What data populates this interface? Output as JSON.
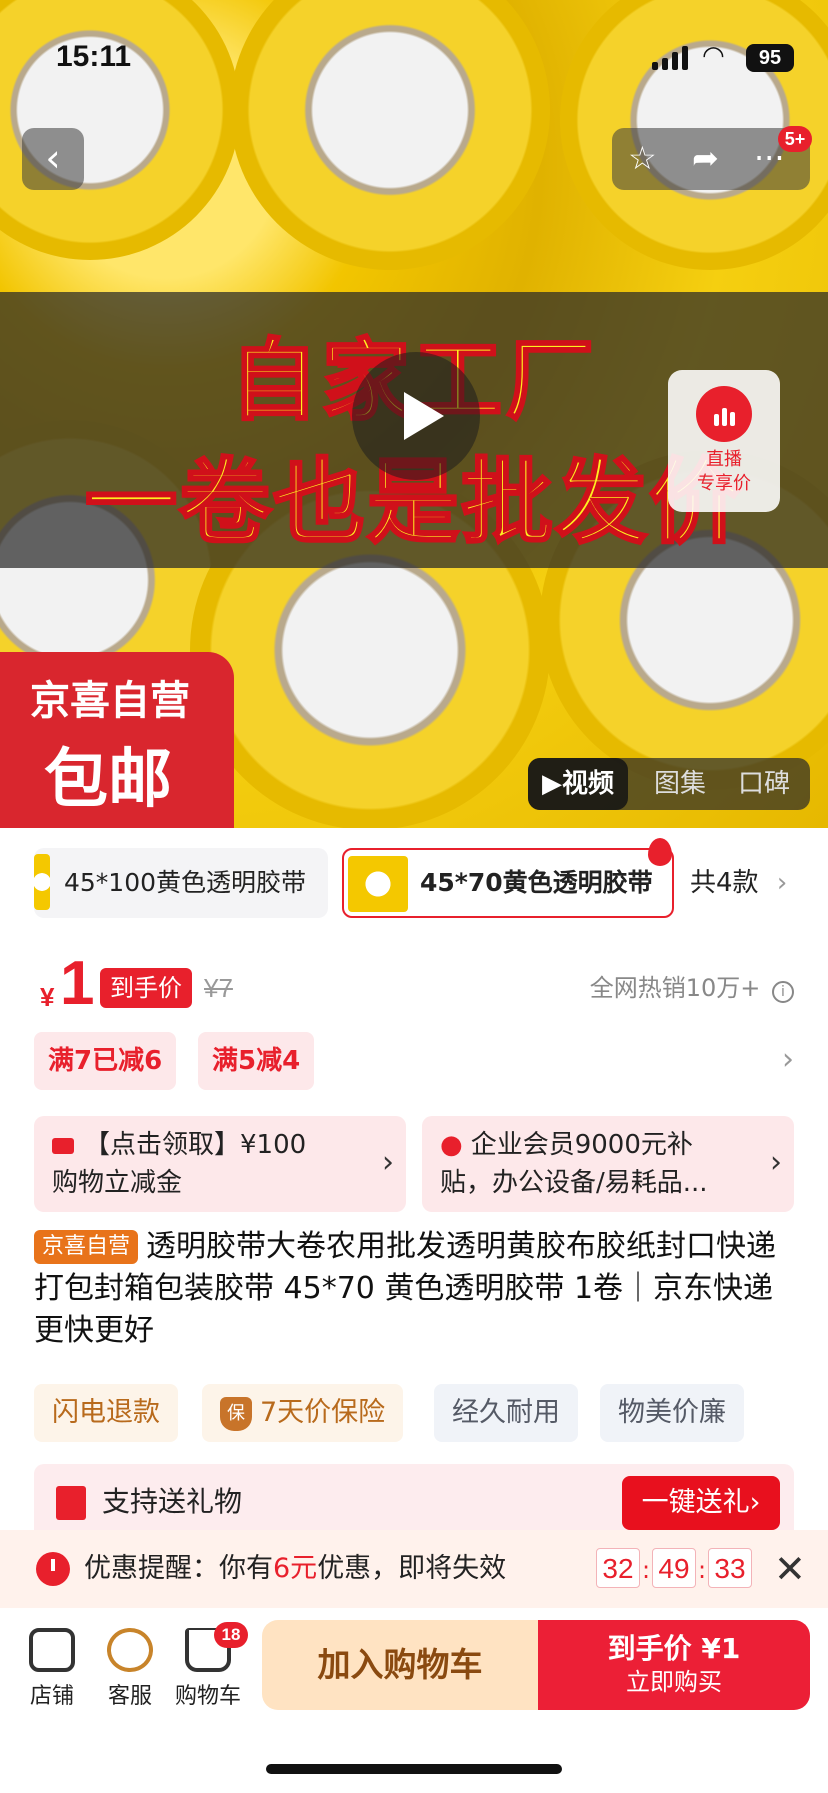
{
  "status_bar": {
    "time": "15:11",
    "battery": "95"
  },
  "nav": {
    "notification_count": "5+"
  },
  "hero": {
    "headline_1": "自家工厂",
    "headline_2": "一卷也是批发价",
    "live_label_1": "直播",
    "live_label_2": "专享价",
    "badge_top": "京喜自营",
    "badge_bottom": "包邮",
    "media_tabs": [
      "▶视频",
      "图集",
      "口碑"
    ]
  },
  "variants": {
    "items": [
      "45*100黄色透明胶带",
      "45*70黄色透明胶带"
    ],
    "more": "共4款"
  },
  "price": {
    "currency": "¥",
    "amount": "1",
    "tag": "到手价",
    "original": "¥7",
    "sales": "全网热销10万+"
  },
  "coupons": [
    "满7已减6",
    "满5减4"
  ],
  "promos": [
    {
      "line1": "【点击领取】¥100",
      "line2": "购物立减金"
    },
    {
      "line1": "企业会员9000元补",
      "line2": "贴，办公设备/易耗品..."
    }
  ],
  "product": {
    "tag": "京喜自营",
    "title": "透明胶带大卷农用批发透明黄胶布胶纸封口快递打包封箱包装胶带 45*70 黄色透明胶带 1卷｜京东快递 更快更好"
  },
  "features": [
    "闪电退款",
    "7天价保险",
    "经久耐用",
    "物美价廉"
  ],
  "feature_shield": "保",
  "gift": {
    "label": "支持送礼物",
    "button": "一键送礼›"
  },
  "reminder": {
    "prefix": "优惠提醒：你有",
    "amount": "6元",
    "suffix": "优惠，即将失效",
    "hours": "32",
    "minutes": "49",
    "seconds": "33"
  },
  "bottom_bar": {
    "shop": "店铺",
    "service": "客服",
    "cart": "购物车",
    "cart_count": "18",
    "add_to_cart": "加入购物车",
    "buy_line1": "到手价 ¥1",
    "buy_line2": "立即购买"
  },
  "colors": {
    "accent": "#e8202c",
    "buy_button": "#ec1f36",
    "cart_button": "#ffe3c2"
  }
}
